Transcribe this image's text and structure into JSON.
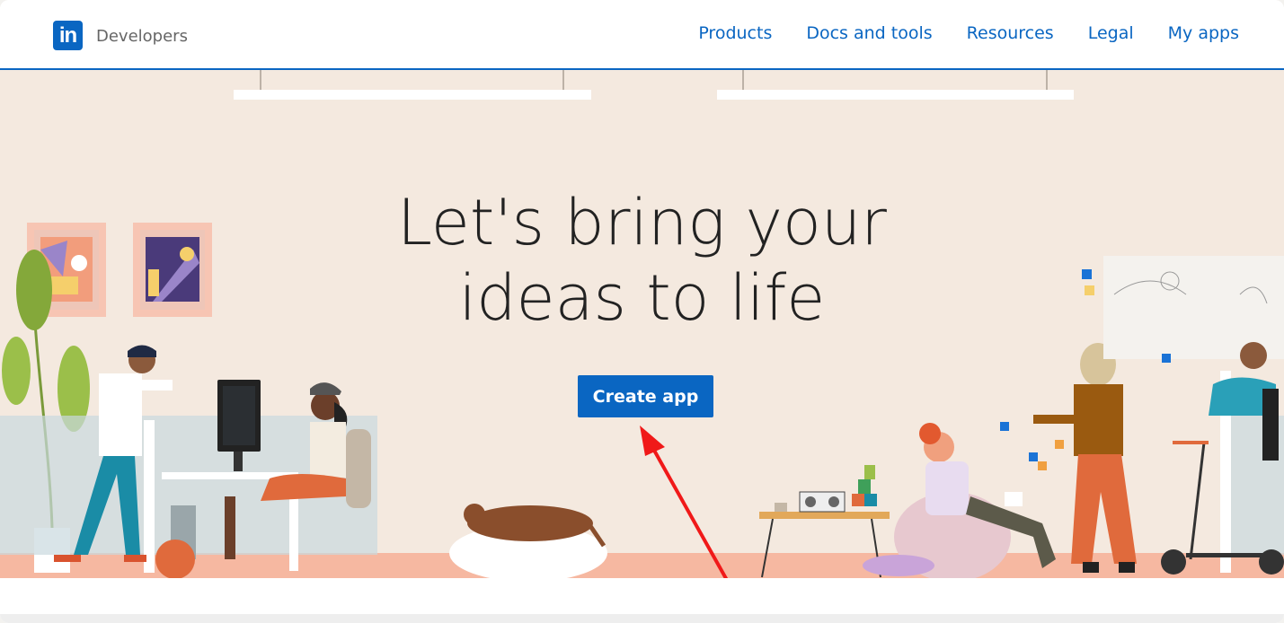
{
  "nav": {
    "brand": "Developers",
    "logo_text": "in",
    "items": [
      {
        "label": "Products"
      },
      {
        "label": "Docs and tools"
      },
      {
        "label": "Resources"
      },
      {
        "label": "Legal"
      },
      {
        "label": "My apps"
      }
    ]
  },
  "hero": {
    "headline_line1": "Let's bring your",
    "headline_line2": "ideas to life",
    "cta_label": "Create app"
  },
  "colors": {
    "brand_blue": "#0a66c2",
    "hero_bg": "#f4e9df",
    "floor": "#f6b8a1",
    "arrow": "#f01919"
  },
  "icons": [
    "linkedin-logo-icon",
    "red-arrow-annotation"
  ]
}
